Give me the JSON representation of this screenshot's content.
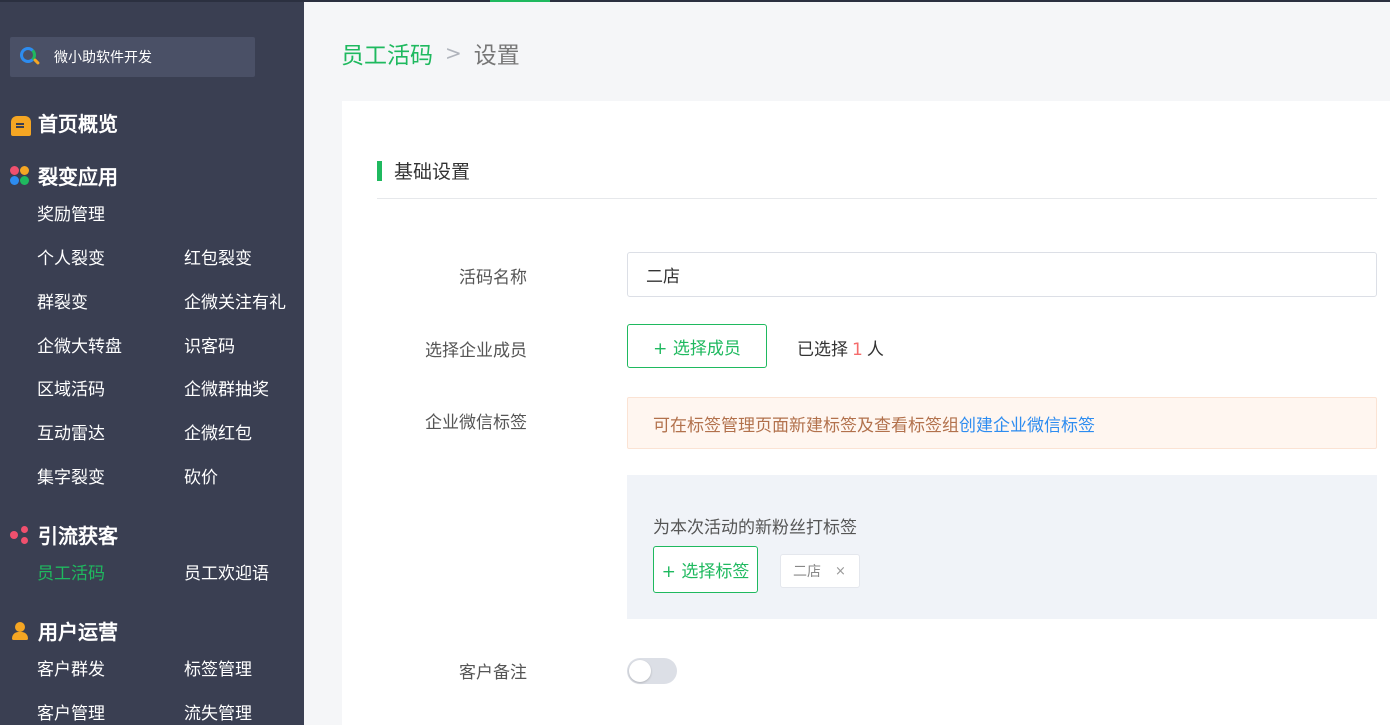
{
  "brand": {
    "name": "微小助软件开发"
  },
  "sidebar": {
    "sections": [
      {
        "label": "首页概览",
        "icon": "home-icon"
      },
      {
        "label": "裂变应用",
        "icon": "apps-grid-icon"
      },
      {
        "label": "引流获客",
        "icon": "share-icon"
      },
      {
        "label": "用户运营",
        "icon": "user-icon"
      }
    ],
    "items": {
      "reward": "奖励管理",
      "personal_fission": "个人裂变",
      "redpacket_fission": "红包裂变",
      "group_fission": "群裂变",
      "wecom_follow": "企微关注有礼",
      "wecom_wheel": "企微大转盘",
      "customer_code": "识客码",
      "region_code": "区域活码",
      "wecom_group_lottery": "企微群抽奖",
      "radar": "互动雷达",
      "wecom_redpacket": "企微红包",
      "word_fission": "集字裂变",
      "bargain": "砍价",
      "staff_code": "员工活码",
      "staff_welcome": "员工欢迎语",
      "group_send": "客户群发",
      "tag_manage": "标签管理",
      "customer_manage": "客户管理",
      "churn_manage": "流失管理"
    }
  },
  "breadcrumb": {
    "parent": "员工活码",
    "separator": ">",
    "current": "设置"
  },
  "section": {
    "title": "基础设置"
  },
  "form": {
    "name_label": "活码名称",
    "name_value": "二店",
    "member_label": "选择企业成员",
    "member_button": "+ 选择成员",
    "selected_prefix": "已选择",
    "selected_count": "1",
    "selected_suffix": "人",
    "tag_label": "企业微信标签",
    "notice_text": "可在标签管理页面新建标签及查看标签组",
    "notice_link": "创建企业微信标签",
    "tag_hint": "为本次活动的新粉丝打标签",
    "tag_button": "+ 选择标签",
    "tags": [
      {
        "label": "二店",
        "close": "×"
      }
    ],
    "remark_label": "客户备注",
    "remark_enabled": false
  },
  "colors": {
    "accent": "#1fb95f",
    "sidebar_bg": "#3a3f52",
    "link": "#2d8cf0",
    "count": "#f56c6c"
  }
}
